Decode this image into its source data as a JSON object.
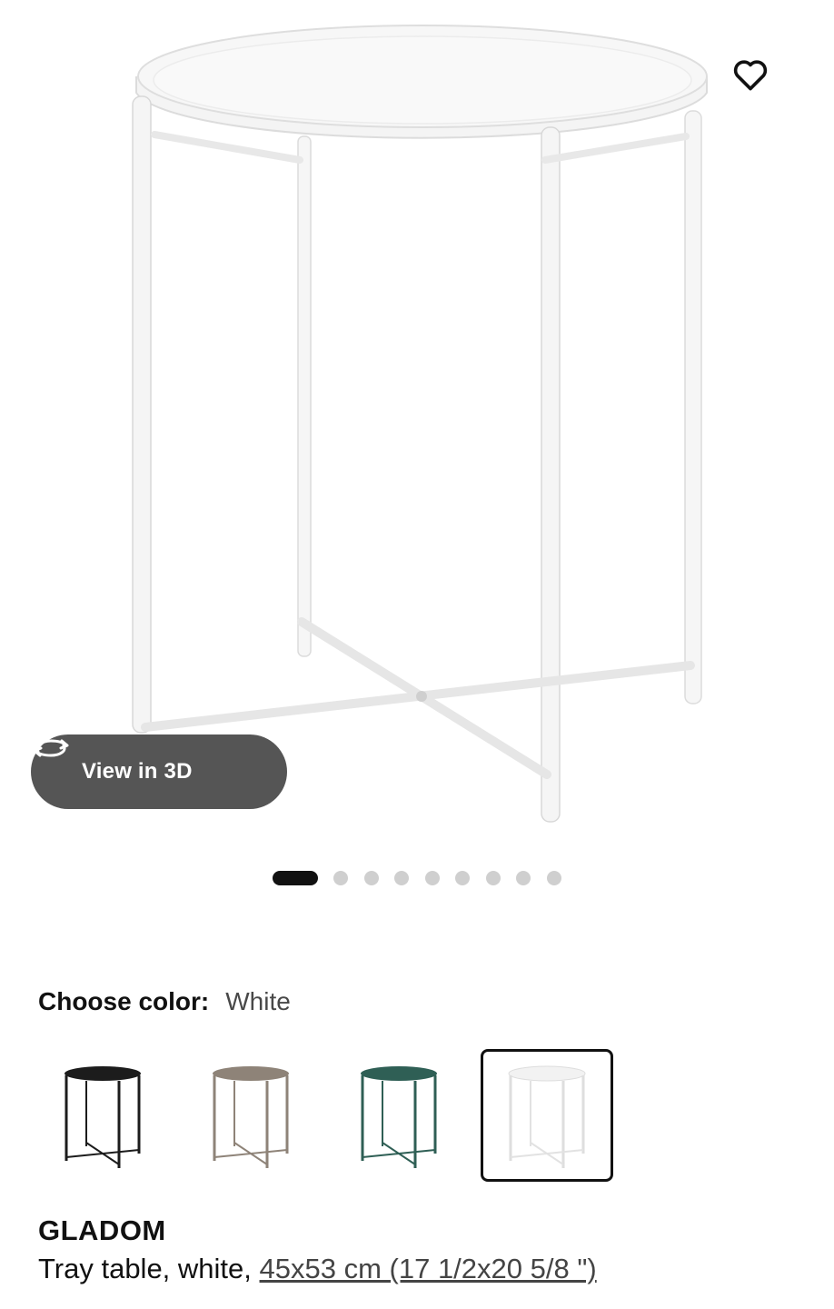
{
  "product_image": {
    "alt": "white tray table",
    "favorite_icon": "heart-outline-icon"
  },
  "view_3d": {
    "label": "View in 3D",
    "icon": "rotate-3d-icon"
  },
  "carousel": {
    "total": 9,
    "active_index": 0
  },
  "color_picker": {
    "label": "Choose color:",
    "selected_value": "White",
    "options": [
      {
        "color": "#1c1c1c"
      },
      {
        "color": "#8e8378"
      },
      {
        "color": "#2f5f55"
      },
      {
        "color": "#e9e9e9"
      }
    ]
  },
  "product": {
    "name": "GLADOM",
    "description_prefix": "Tray table, white, ",
    "size_link": "45x53 cm (17 1/2x20 5/8 \")"
  }
}
